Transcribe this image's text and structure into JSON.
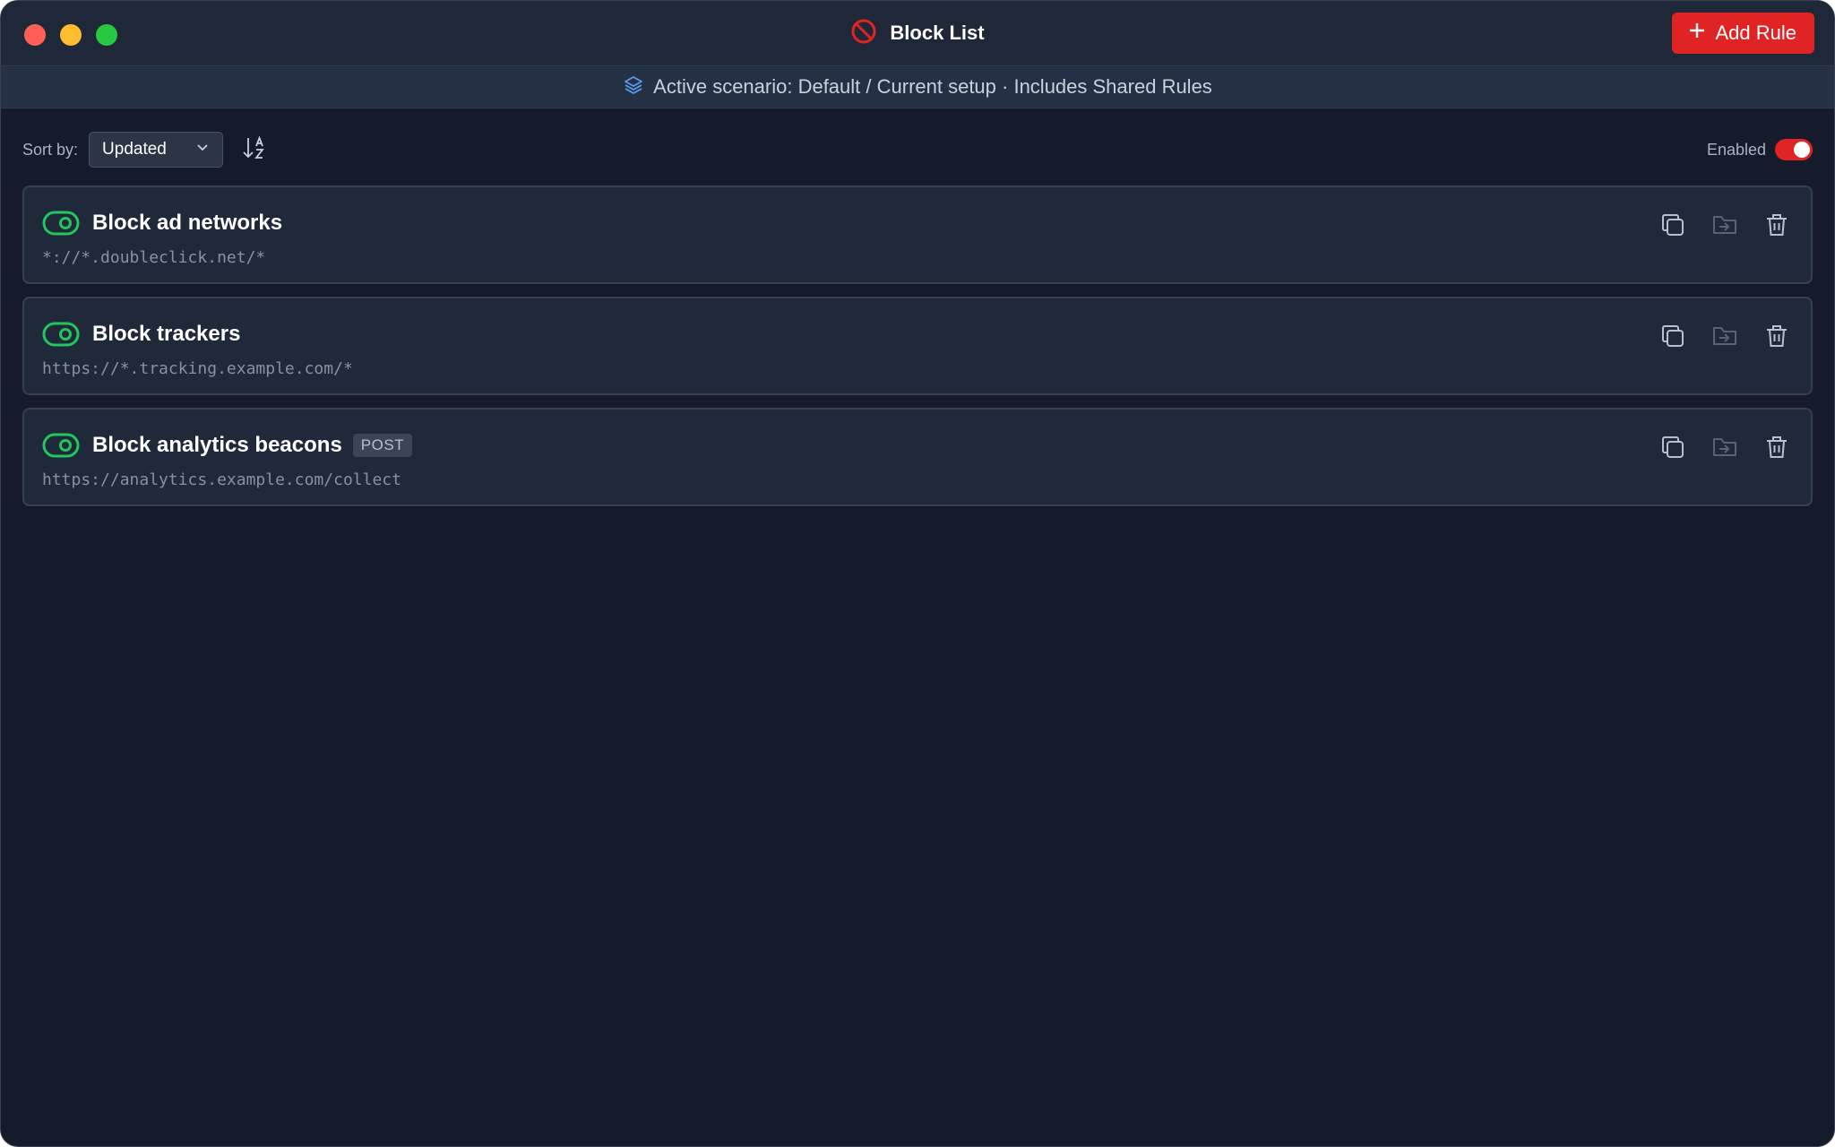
{
  "window": {
    "title": "Block List",
    "colors": {
      "background": "#151b2b",
      "accent": "#e02424",
      "toggle_on": "#22c55e"
    }
  },
  "header": {
    "title_icon": "block-icon",
    "add_button": {
      "icon": "plus-icon",
      "label": "Add Rule"
    }
  },
  "scenario": {
    "icon": "layers-icon",
    "text": "Active scenario: Default / Current setup · Includes Shared Rules"
  },
  "toolbar": {
    "sort_label": "Sort by:",
    "sort_value": "Updated",
    "sort_direction_icon": "sort-alpha-down-icon",
    "enabled_label": "Enabled",
    "enabled": true
  },
  "rules": [
    {
      "name": "Block ad networks",
      "pattern": "*://*.doubleclick.net/*",
      "method": "",
      "enabled": true
    },
    {
      "name": "Block trackers",
      "pattern": "https://*.tracking.example.com/*",
      "method": "",
      "enabled": true
    },
    {
      "name": "Block analytics beacons",
      "pattern": "https://analytics.example.com/collect",
      "method": "POST",
      "enabled": true
    }
  ],
  "rule_actions": [
    "duplicate-icon",
    "move-to-folder-icon",
    "delete-icon"
  ]
}
